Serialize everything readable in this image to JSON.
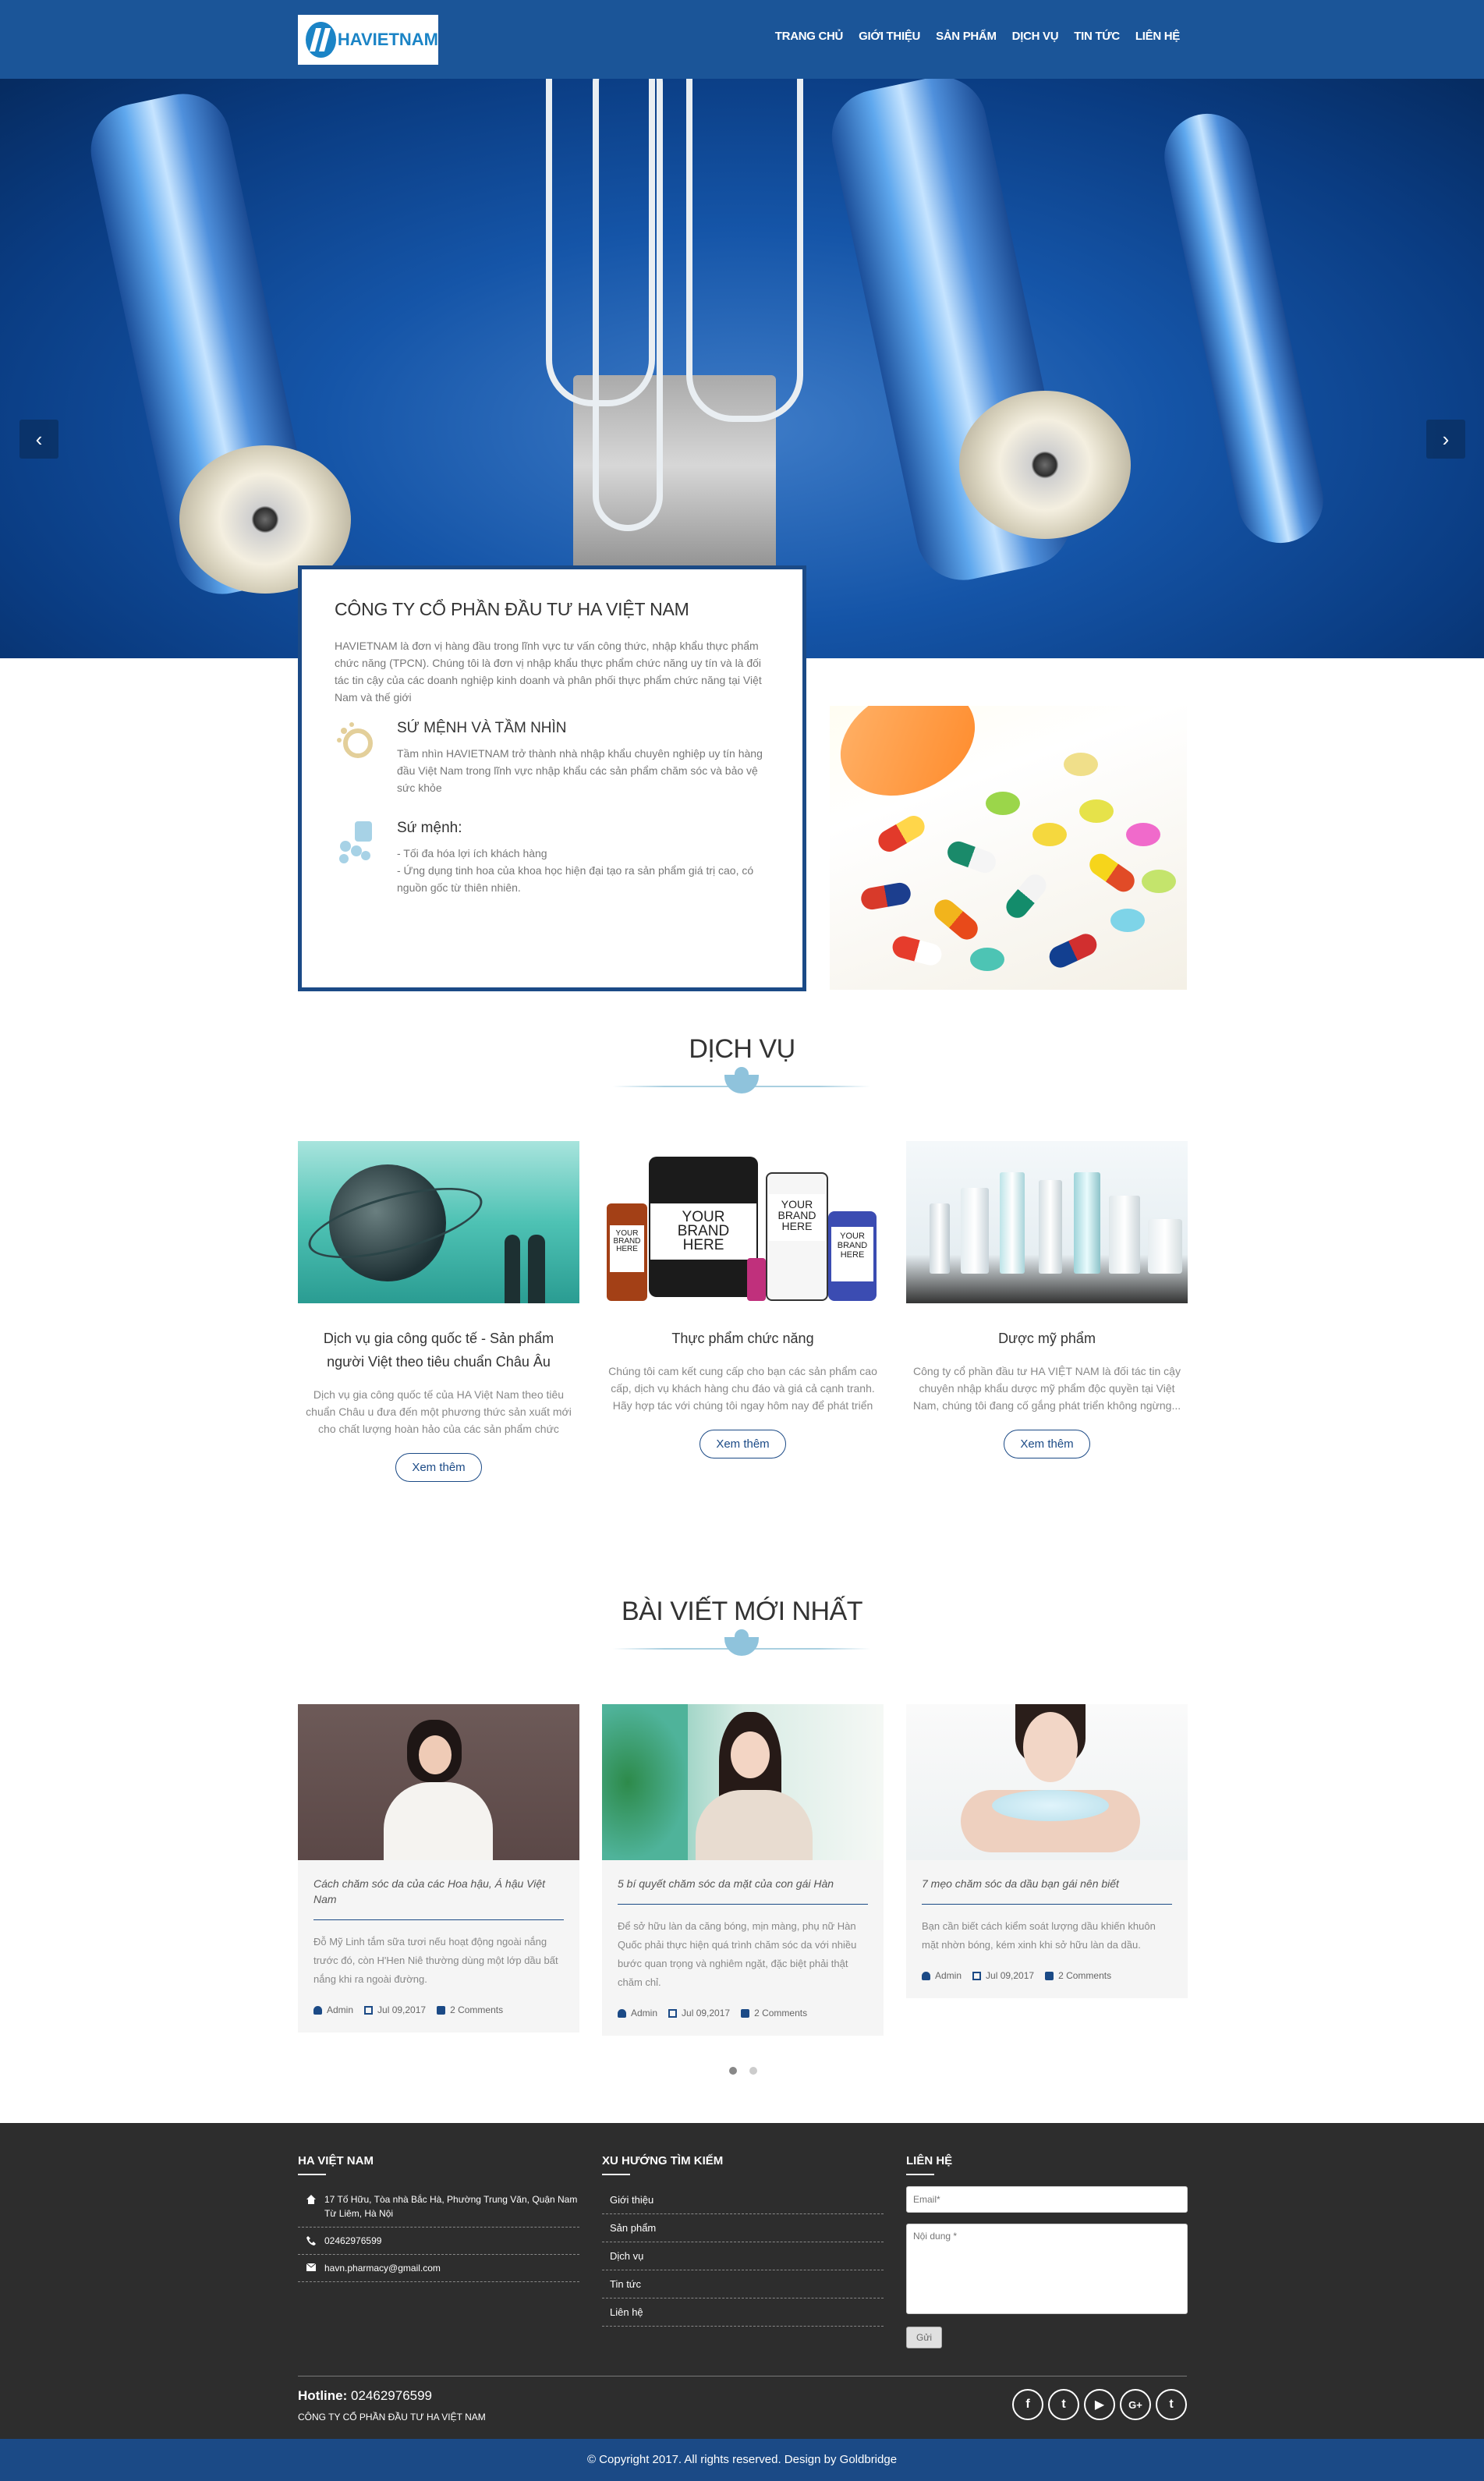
{
  "header": {
    "logo_text": "HAVIETNAM",
    "nav": [
      "TRANG CHỦ",
      "GIỚI THIỆU",
      "SẢN PHẨM",
      "DỊCH VỤ",
      "TIN TỨC",
      "LIÊN HỆ"
    ]
  },
  "hero": {
    "prev_icon": "‹",
    "next_icon": "›"
  },
  "about": {
    "title": "CÔNG TY CỔ PHẦN ĐẦU TƯ HA VIỆT NAM",
    "intro": "HAVIETNAM là đơn vị hàng đầu trong lĩnh vực tư vấn công thức, nhập khẩu thực phẩm chức năng (TPCN). Chúng tôi là đơn vị nhập khẩu thực phẩm chức năng uy tín và là đối tác tin cậy của các doanh nghiệp kinh doanh và phân phối thực phẩm chức năng tại Việt Nam và thế giới",
    "vision_title": "SỨ MỆNH VÀ TẦM NHÌN",
    "vision_text": "Tầm nhìn HAVIETNAM trở thành nhà nhập khẩu chuyên nghiệp uy tín hàng đầu Việt Nam trong lĩnh vực nhập khẩu các sản phẩm chăm sóc và bảo vệ sức khỏe",
    "mission_title": "Sứ mệnh:",
    "mission_line1": "- Tối đa hóa lợi ích khách hàng",
    "mission_line2": "- Ứng dụng tinh hoa của khoa học hiện đại tạo ra sản phẩm giá trị cao, có nguồn gốc từ thiên nhiên."
  },
  "services": {
    "title": "DỊCH VỤ",
    "items": [
      {
        "title": "Dịch vụ gia công quốc tế - Sản phẩm người Việt theo tiêu chuẩn Châu Âu",
        "text": "Dịch vụ gia công quốc tế của HA Việt Nam theo tiêu chuẩn Châu u đưa đến một phương thức sản xuất mới cho chất lượng hoàn hảo của các sản phẩm chức năng...",
        "button": "Xem thêm"
      },
      {
        "title": "Thực phẩm chức năng",
        "text": "Chúng tôi cam kết cung cấp cho bạn các sản phẩm cao cấp, dịch vụ khách hàng chu đáo và giá cả cạnh tranh. Hãy hợp tác với chúng tôi ngay hôm nay để phát triển s...",
        "button": "Xem thêm"
      },
      {
        "title": "Dược mỹ phẩm",
        "text": "Công ty cổ phần đầu tư HA VIỆT NAM là đối tác tin cậy chuyên nhập khẩu dược mỹ phẩm độc quyền tại Việt Nam, chúng tôi đang cố gắng phát triển không ngừng...",
        "button": "Xem thêm"
      }
    ],
    "brand_label": "YOUR BRAND HERE"
  },
  "blog": {
    "title": "BÀI VIẾT MỚI NHẤT",
    "posts": [
      {
        "title": "Cách chăm sóc da của các Hoa hậu, Á hậu Việt Nam",
        "excerpt": "Đỗ Mỹ Linh tắm sữa tươi nếu hoạt động ngoài nắng trước đó, còn H'Hen Niê thường dùng một lớp dầu bất nắng khi ra ngoài đường.",
        "author": "Admin",
        "date": "Jul 09,2017",
        "comments": "2 Comments"
      },
      {
        "title": "5 bí quyết chăm sóc da mặt của con gái Hàn",
        "excerpt": "Để sở hữu làn da căng bóng, mịn màng, phụ nữ Hàn Quốc phải thực hiện quá trình chăm sóc da với nhiều bước quan trọng và nghiêm ngặt, đặc biệt phải thật chăm chỉ.",
        "author": "Admin",
        "date": "Jul 09,2017",
        "comments": "2 Comments"
      },
      {
        "title": "7 mẹo chăm sóc da dầu bạn gái nên biết",
        "excerpt": "Bạn cần biết cách kiểm soát lượng dầu khiến khuôn mặt nhờn bóng, kém xinh khi sở hữu làn da dầu.",
        "author": "Admin",
        "date": "Jul 09,2017",
        "comments": "2 Comments"
      }
    ]
  },
  "footer": {
    "col1_title": "HA VIỆT NAM",
    "address": "17 Tố Hữu, Tòa nhà Bắc Hà, Phường Trung Văn, Quận Nam Từ Liêm, Hà Nội",
    "phone": "02462976599",
    "email": "havn.pharmacy@gmail.com",
    "col2_title": "XU HƯỚNG TÌM KIẾM",
    "links": [
      "Giới thiệu",
      "Sản phẩm",
      "Dịch vụ",
      "Tin tức",
      "Liên hệ"
    ],
    "col3_title": "LIÊN HỆ",
    "email_placeholder": "Email*",
    "content_placeholder": "Nội dung *",
    "send_label": "Gửi",
    "hotline_label": "Hotline:",
    "hotline_value": "02462976599",
    "company": "CÔNG TY CỔ PHẦN ĐẦU TƯ HA VIỆT NAM",
    "socials": [
      "f",
      "t",
      "▶",
      "G+",
      "t"
    ],
    "copyright": "© Copyright 2017. All rights reserved. Design by Goldbridge"
  }
}
